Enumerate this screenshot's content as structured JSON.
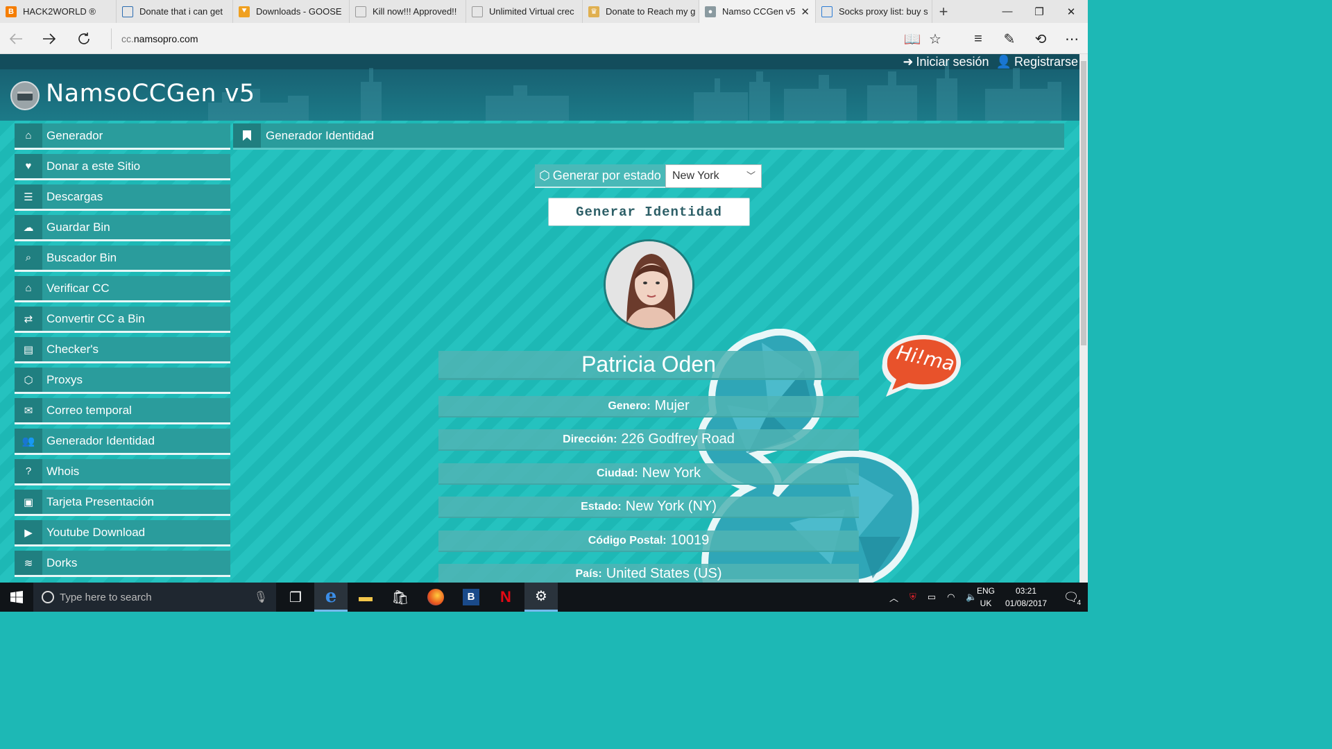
{
  "browser": {
    "tabs": [
      {
        "title": "HACK2WORLD ®",
        "favicon": "blogger-icon",
        "color": "#f57d00",
        "glyph": "B"
      },
      {
        "title": "Donate that i can get",
        "favicon": "page-icon",
        "color": "#2b6cb0",
        "glyph": ""
      },
      {
        "title": "Downloads - GOOSE",
        "favicon": "goose-icon",
        "color": "#f0a020",
        "glyph": "⯆"
      },
      {
        "title": "Kill now!!! Approved!!",
        "favicon": "page-icon",
        "color": "#999999",
        "glyph": ""
      },
      {
        "title": "Unlimited Virtual crec",
        "favicon": "page-icon",
        "color": "#999999",
        "glyph": ""
      },
      {
        "title": "Donate to Reach my g",
        "favicon": "crown-icon",
        "color": "#e0b050",
        "glyph": "♛"
      },
      {
        "title": "Namso CCGen v5",
        "favicon": "namso-icon",
        "color": "#8a9aa0",
        "glyph": "●",
        "active": true
      },
      {
        "title": "Socks proxy list: buy s",
        "favicon": "page-icon",
        "color": "#2b7bd4",
        "glyph": ""
      }
    ],
    "new_tab": "+",
    "window": {
      "minimize": "—",
      "maximize": "❐",
      "close": "✕"
    },
    "url_prefix": "cc.",
    "url_domain": "namsopro.com"
  },
  "site": {
    "logo_text": "NamsoCCGen v5",
    "login": "Iniciar sesión",
    "register": "Registrarse"
  },
  "sidebar": {
    "items": [
      {
        "label": "Generador",
        "icon": "home-icon",
        "glyph": "⌂"
      },
      {
        "label": "Donar a este Sitio",
        "icon": "heart-circle-icon",
        "glyph": "♥"
      },
      {
        "label": "Descargas",
        "icon": "list-icon",
        "glyph": "☰"
      },
      {
        "label": "Guardar Bin",
        "icon": "cloud-icon",
        "glyph": "☁"
      },
      {
        "label": "Buscador Bin",
        "icon": "search-icon",
        "glyph": "⌕"
      },
      {
        "label": "Verificar CC",
        "icon": "home-icon",
        "glyph": "⌂"
      },
      {
        "label": "Convertir CC a Bin",
        "icon": "exchange-icon",
        "glyph": "⇄"
      },
      {
        "label": "Checker's",
        "icon": "card-icon",
        "glyph": "▤"
      },
      {
        "label": "Proxys",
        "icon": "hexagon-icon",
        "glyph": "⬡"
      },
      {
        "label": "Correo temporal",
        "icon": "envelope-icon",
        "glyph": "✉"
      },
      {
        "label": "Generador Identidad",
        "icon": "users-icon",
        "glyph": "👥"
      },
      {
        "label": "Whois",
        "icon": "question-icon",
        "glyph": "?"
      },
      {
        "label": "Tarjeta Presentación",
        "icon": "id-badge-icon",
        "glyph": "▣"
      },
      {
        "label": "Youtube Download",
        "icon": "youtube-icon",
        "glyph": "▶"
      },
      {
        "label": "Dorks",
        "icon": "signal-icon",
        "glyph": "≋"
      }
    ]
  },
  "section": {
    "title": "Generador Identidad"
  },
  "form": {
    "state_label": "Generar por estado",
    "state_value": "New York",
    "generate_button": "Generar Identidad"
  },
  "identity": {
    "name": "Patricia Oden",
    "fields": [
      {
        "key": "Genero:",
        "value": "Mujer"
      },
      {
        "key": "Dirección:",
        "value": "226 Godfrey Road"
      },
      {
        "key": "Ciudad:",
        "value": "New York"
      },
      {
        "key": "Estado:",
        "value": "New York (NY)"
      },
      {
        "key": "Código Postal:",
        "value": "10019"
      },
      {
        "key": "País:",
        "value": "United States (US)"
      }
    ]
  },
  "bubble_text": "Hi!ma",
  "taskbar": {
    "search_placeholder": "Type here to search",
    "lang_top": "ENG",
    "lang_bottom": "UK",
    "time": "03:21",
    "date": "01/08/2017",
    "notifications": "4"
  },
  "colors": {
    "teal": "#1db8b5",
    "nav_bg": "#2a9c9c",
    "icon_bg": "#207f80",
    "header": "#175a6c",
    "bubble": "#e8522b"
  }
}
